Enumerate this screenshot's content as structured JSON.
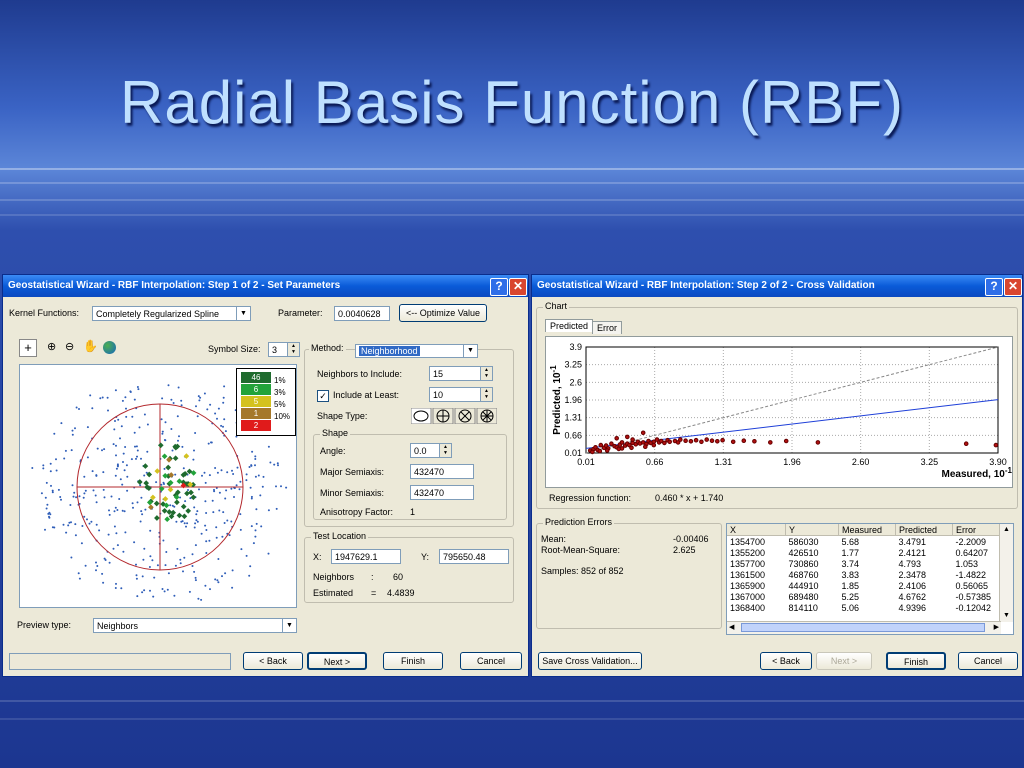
{
  "slide": {
    "title": "Radial Basis Function (RBF)"
  },
  "win1": {
    "title": "Geostatistical Wizard - RBF Interpolation: Step 1 of 2 - Set Parameters",
    "kernel_label": "Kernel Functions:",
    "kernel_value": "Completely Regularized Spline",
    "param_label": "Parameter:",
    "param_value": "0.0040628",
    "optimize_label": "<-- Optimize Value",
    "symbol_label": "Symbol Size:",
    "symbol_value": "3",
    "method_label": "Method:",
    "method_value": "Neighborhood",
    "neighbors_label": "Neighbors to Include:",
    "neighbors_value": "15",
    "include_label": "Include at Least:",
    "include_value": "10",
    "shape_type_label": "Shape Type:",
    "shape_group": "Shape",
    "angle_label": "Angle:",
    "angle_value": "0.0",
    "major_label": "Major Semiaxis:",
    "major_value": "432470",
    "minor_label": "Minor Semiaxis:",
    "minor_value": "432470",
    "aniso_label": "Anisotropy Factor:",
    "aniso_value": "1",
    "test_group": "Test Location",
    "x_label": "X:",
    "x_value": "1947629.1",
    "y_label": "Y:",
    "y_value": "795650.48",
    "nb_label": "Neighbors",
    "nb_colon": ":",
    "nb_value": "60",
    "est_label": "Estimated",
    "est_eq": "=",
    "est_value": "4.4839",
    "preview_label": "Preview type:",
    "preview_value": "Neighbors",
    "legend": [
      {
        "value": "46",
        "pct": "1%",
        "color": "#1f6b2e"
      },
      {
        "value": "6",
        "pct": "3%",
        "color": "#22a33a"
      },
      {
        "value": "5",
        "pct": "5%",
        "color": "#d4c21e"
      },
      {
        "value": "1",
        "pct": "10%",
        "color": "#a5782a"
      },
      {
        "value": "2",
        "pct": "",
        "color": "#e01b1b"
      }
    ],
    "back": "< Back",
    "next": "Next >",
    "finish": "Finish",
    "cancel": "Cancel"
  },
  "win2": {
    "title": "Geostatistical Wizard - RBF Interpolation: Step 2 of 2 - Cross Validation",
    "chart_group": "Chart",
    "tab_predicted": "Predicted",
    "tab_error": "Error",
    "regression_label": "Regression function:",
    "regression_value": "0.460 * x + 1.740",
    "errors_group": "Prediction Errors",
    "mean_label": "Mean:",
    "mean_value": "-0.00406",
    "rms_label": "Root-Mean-Square:",
    "rms_value": "2.625",
    "samples": "Samples: 852 of 852",
    "columns": [
      "X",
      "Y",
      "Measured",
      "Predicted",
      "Error"
    ],
    "rows": [
      [
        "1354700",
        "586030",
        "5.68",
        "3.4791",
        "-2.2009"
      ],
      [
        "1355200",
        "426510",
        "1.77",
        "2.4121",
        "0.64207"
      ],
      [
        "1357700",
        "730860",
        "3.74",
        "4.793",
        "1.053"
      ],
      [
        "1361500",
        "468760",
        "3.83",
        "2.3478",
        "-1.4822"
      ],
      [
        "1365900",
        "444910",
        "1.85",
        "2.4106",
        "0.56065"
      ],
      [
        "1367000",
        "689480",
        "5.25",
        "4.6762",
        "-0.57385"
      ],
      [
        "1368400",
        "814110",
        "5.06",
        "4.9396",
        "-0.12042"
      ]
    ],
    "save_cv": "Save Cross Validation...",
    "back": "< Back",
    "next": "Next >",
    "finish": "Finish",
    "cancel": "Cancel"
  },
  "chart_data": {
    "type": "scatter",
    "xlabel": "Measured, 10",
    "xlabel_exp": "-1",
    "ylabel": "Predicted, 10",
    "ylabel_exp": "-1",
    "xlim": [
      0.01,
      3.9
    ],
    "ylim": [
      0.01,
      3.9
    ],
    "xticks": [
      "0.01",
      "0.66",
      "1.31",
      "1.96",
      "2.60",
      "3.25",
      "3.90"
    ],
    "yticks": [
      "0.01",
      "0.66",
      "1.31",
      "1.96",
      "2.6",
      "3.25",
      "3.9"
    ],
    "regression": {
      "slope": 0.46,
      "intercept": 0.174
    },
    "points": [
      [
        0.05,
        0.1
      ],
      [
        0.08,
        0.15
      ],
      [
        0.1,
        0.22
      ],
      [
        0.12,
        0.12
      ],
      [
        0.15,
        0.3
      ],
      [
        0.18,
        0.2
      ],
      [
        0.2,
        0.28
      ],
      [
        0.22,
        0.18
      ],
      [
        0.25,
        0.35
      ],
      [
        0.28,
        0.26
      ],
      [
        0.3,
        0.22
      ],
      [
        0.33,
        0.32
      ],
      [
        0.35,
        0.4
      ],
      [
        0.38,
        0.28
      ],
      [
        0.4,
        0.35
      ],
      [
        0.42,
        0.3
      ],
      [
        0.45,
        0.38
      ],
      [
        0.48,
        0.33
      ],
      [
        0.5,
        0.42
      ],
      [
        0.52,
        0.36
      ],
      [
        0.55,
        0.4
      ],
      [
        0.58,
        0.34
      ],
      [
        0.6,
        0.45
      ],
      [
        0.62,
        0.38
      ],
      [
        0.65,
        0.42
      ],
      [
        0.68,
        0.5
      ],
      [
        0.7,
        0.4
      ],
      [
        0.72,
        0.45
      ],
      [
        0.75,
        0.38
      ],
      [
        0.78,
        0.48
      ],
      [
        0.8,
        0.42
      ],
      [
        0.85,
        0.45
      ],
      [
        0.88,
        0.4
      ],
      [
        0.9,
        0.5
      ],
      [
        0.95,
        0.46
      ],
      [
        1.0,
        0.44
      ],
      [
        1.05,
        0.48
      ],
      [
        1.1,
        0.42
      ],
      [
        1.15,
        0.5
      ],
      [
        1.2,
        0.46
      ],
      [
        1.25,
        0.44
      ],
      [
        1.3,
        0.48
      ],
      [
        1.4,
        0.42
      ],
      [
        1.5,
        0.46
      ],
      [
        1.6,
        0.44
      ],
      [
        1.75,
        0.4
      ],
      [
        1.9,
        0.45
      ],
      [
        0.07,
        0.05
      ],
      [
        0.14,
        0.08
      ],
      [
        0.21,
        0.1
      ],
      [
        0.32,
        0.16
      ],
      [
        0.44,
        0.2
      ],
      [
        0.57,
        0.24
      ],
      [
        0.3,
        0.55
      ],
      [
        0.4,
        0.6
      ],
      [
        0.55,
        0.75
      ],
      [
        0.45,
        0.5
      ],
      [
        0.65,
        0.3
      ],
      [
        0.35,
        0.18
      ],
      [
        3.6,
        0.35
      ],
      [
        3.88,
        0.3
      ],
      [
        2.2,
        0.4
      ]
    ]
  }
}
